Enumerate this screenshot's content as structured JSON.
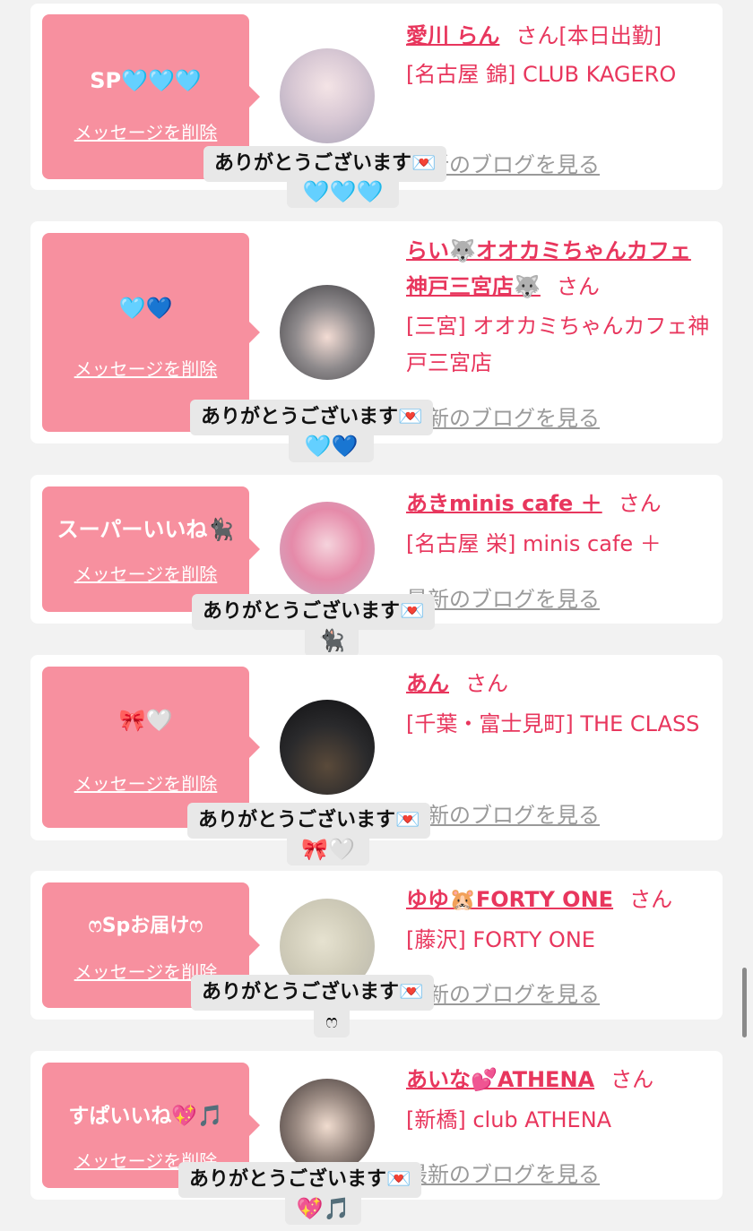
{
  "delete_label": "メッセージを削除",
  "blog_label": "最新のブログを見る",
  "thanks_label": "ありがとうございます💌",
  "honorific": "さん",
  "items": [
    {
      "message": "SP🩵🩵🩵",
      "name": "愛川 らん",
      "name_suffix": "[本日出勤]",
      "store": "[名古屋 錦] CLUB KAGERO",
      "reply": "🩵🩵🩵"
    },
    {
      "message": "🩵💙",
      "name": "らい🐺オオカミちゃんカフェ神戸三宮店🐺",
      "name_suffix": "",
      "store": "[三宮] オオカミちゃんカフェ神戸三宮店",
      "reply": "🩵💙"
    },
    {
      "message": "スーパーいいね🐈‍⬛",
      "name": "あきminis cafe ＋",
      "name_suffix": "",
      "store": "[名古屋 栄] minis cafe ＋",
      "reply": "🐈‍⬛"
    },
    {
      "message": "🎀🤍",
      "name": "あん",
      "name_suffix": "",
      "store": "[千葉・富士見町] THE CLASS",
      "reply": "🎀🤍"
    },
    {
      "message": "ෆSpお届けෆ",
      "name": "ゆゆ🐹FORTY ONE",
      "name_suffix": "",
      "store": "[藤沢] FORTY ONE",
      "reply": "ෆ"
    },
    {
      "message": "すぱいいね💖🎵",
      "name": "あいな💕ATHENA",
      "name_suffix": "",
      "store": "[新橋] club ATHENA",
      "reply": "💖🎵"
    }
  ]
}
